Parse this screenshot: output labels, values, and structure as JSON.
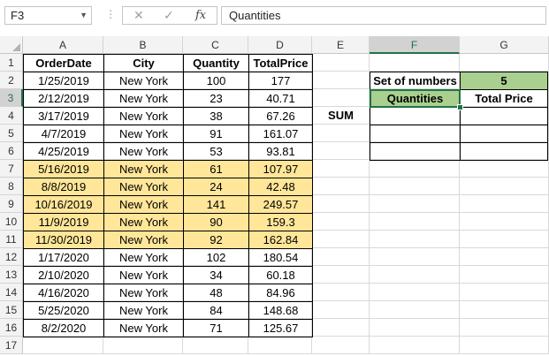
{
  "formula_bar": {
    "name_box": "F3",
    "formula": "Quantities",
    "cancel_icon": "✕",
    "enter_icon": "✓",
    "fx_label": "fx"
  },
  "columns": [
    "A",
    "B",
    "C",
    "D",
    "E",
    "F",
    "G"
  ],
  "rows": [
    "1",
    "2",
    "3",
    "4",
    "5",
    "6",
    "7",
    "8",
    "9",
    "10",
    "11",
    "12",
    "13",
    "14",
    "15",
    "16",
    "17"
  ],
  "headers": {
    "order_date": "OrderDate",
    "city": "City",
    "quantity": "Quantity",
    "total_price": "TotalPrice"
  },
  "data_rows": [
    {
      "date": "1/25/2019",
      "city": "New York",
      "qty": "100",
      "price": "177",
      "highlight": false
    },
    {
      "date": "2/12/2019",
      "city": "New York",
      "qty": "23",
      "price": "40.71",
      "highlight": false
    },
    {
      "date": "3/17/2019",
      "city": "New York",
      "qty": "38",
      "price": "67.26",
      "highlight": false
    },
    {
      "date": "4/7/2019",
      "city": "New York",
      "qty": "91",
      "price": "161.07",
      "highlight": false
    },
    {
      "date": "4/25/2019",
      "city": "New York",
      "qty": "53",
      "price": "93.81",
      "highlight": false
    },
    {
      "date": "5/16/2019",
      "city": "New York",
      "qty": "61",
      "price": "107.97",
      "highlight": true
    },
    {
      "date": "8/8/2019",
      "city": "New York",
      "qty": "24",
      "price": "42.48",
      "highlight": true
    },
    {
      "date": "10/16/2019",
      "city": "New York",
      "qty": "141",
      "price": "249.57",
      "highlight": true
    },
    {
      "date": "11/9/2019",
      "city": "New York",
      "qty": "90",
      "price": "159.3",
      "highlight": true
    },
    {
      "date": "11/30/2019",
      "city": "New York",
      "qty": "92",
      "price": "162.84",
      "highlight": true
    },
    {
      "date": "1/17/2020",
      "city": "New York",
      "qty": "102",
      "price": "180.54",
      "highlight": false
    },
    {
      "date": "2/10/2020",
      "city": "New York",
      "qty": "34",
      "price": "60.18",
      "highlight": false
    },
    {
      "date": "4/16/2020",
      "city": "New York",
      "qty": "48",
      "price": "84.96",
      "highlight": false
    },
    {
      "date": "5/25/2020",
      "city": "New York",
      "qty": "84",
      "price": "148.68",
      "highlight": false
    },
    {
      "date": "8/2/2020",
      "city": "New York",
      "qty": "71",
      "price": "125.67",
      "highlight": false
    }
  ],
  "side_table": {
    "set_label": "Set of numbers",
    "set_value": "5",
    "quantities_header": "Quantities",
    "total_price_header": "Total Price",
    "sum_label": "SUM"
  },
  "colors": {
    "highlight": "#ffe699",
    "green": "#a9d08e",
    "selection": "#217346"
  }
}
